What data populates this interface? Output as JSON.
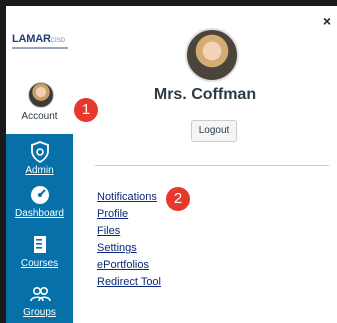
{
  "logo": {
    "brand": "LAMAR",
    "suffix": "CISD"
  },
  "account": {
    "label": "Account"
  },
  "nav": {
    "items": [
      {
        "label": "Admin",
        "icon": "shield-gear-icon"
      },
      {
        "label": "Dashboard",
        "icon": "speedometer-icon"
      },
      {
        "label": "Courses",
        "icon": "book-icon"
      },
      {
        "label": "Groups",
        "icon": "people-icon"
      }
    ]
  },
  "tray": {
    "user_name": "Mrs. Coffman",
    "logout_label": "Logout",
    "close_label": "×",
    "links": [
      {
        "label": "Notifications"
      },
      {
        "label": "Profile"
      },
      {
        "label": "Files"
      },
      {
        "label": "Settings"
      },
      {
        "label": "ePortfolios"
      },
      {
        "label": "Redirect Tool"
      }
    ]
  },
  "callouts": {
    "one": "1",
    "two": "2"
  },
  "colors": {
    "nav_bg": "#0770a8",
    "callout": "#e8382b",
    "link": "#0b2a78"
  }
}
